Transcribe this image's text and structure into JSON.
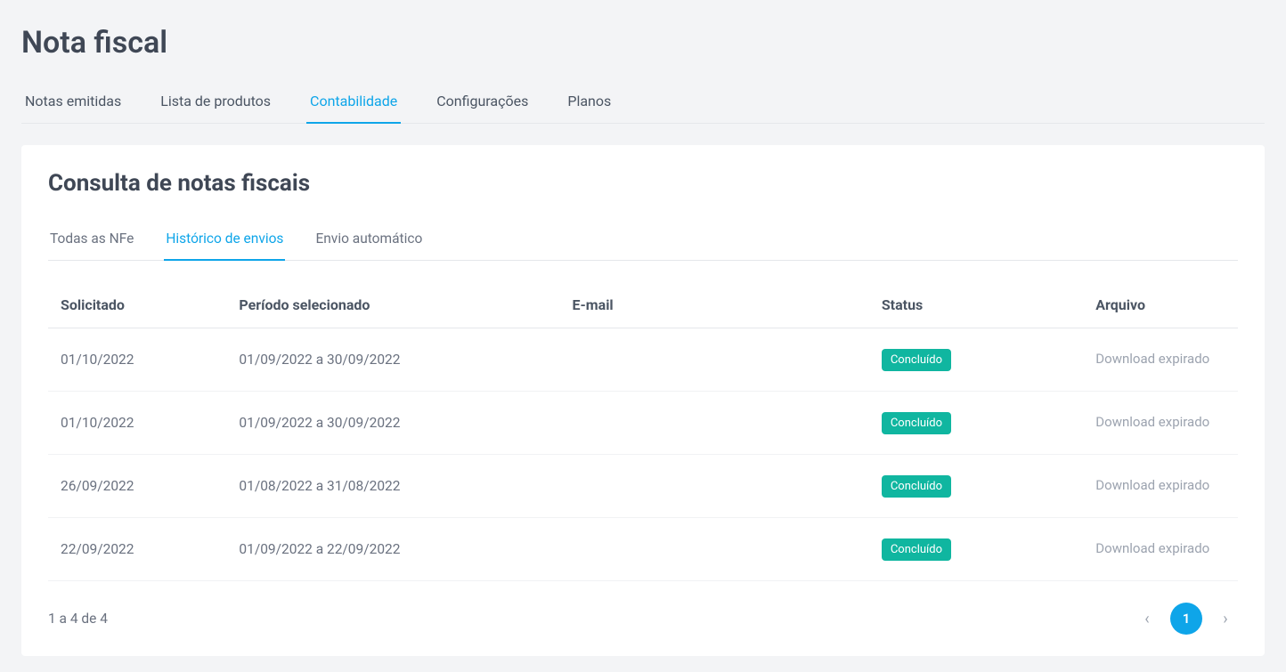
{
  "page": {
    "title": "Nota fiscal"
  },
  "mainTabs": [
    {
      "label": "Notas emitidas",
      "active": false
    },
    {
      "label": "Lista de produtos",
      "active": false
    },
    {
      "label": "Contabilidade",
      "active": true
    },
    {
      "label": "Configurações",
      "active": false
    },
    {
      "label": "Planos",
      "active": false
    }
  ],
  "card": {
    "title": "Consulta de notas fiscais"
  },
  "subTabs": [
    {
      "label": "Todas as NFe",
      "active": false
    },
    {
      "label": "Histórico de envios",
      "active": true
    },
    {
      "label": "Envio automático",
      "active": false
    }
  ],
  "table": {
    "headers": {
      "solicitado": "Solicitado",
      "periodo": "Período selecionado",
      "email": "E-mail",
      "status": "Status",
      "arquivo": "Arquivo"
    },
    "rows": [
      {
        "solicitado": "01/10/2022",
        "periodo": "01/09/2022 a 30/09/2022",
        "email": "",
        "status": "Concluído",
        "arquivo": "Download expirado"
      },
      {
        "solicitado": "01/10/2022",
        "periodo": "01/09/2022 a 30/09/2022",
        "email": "",
        "status": "Concluído",
        "arquivo": "Download expirado"
      },
      {
        "solicitado": "26/09/2022",
        "periodo": "01/08/2022 a 31/08/2022",
        "email": "",
        "status": "Concluído",
        "arquivo": "Download expirado"
      },
      {
        "solicitado": "22/09/2022",
        "periodo": "01/09/2022 a 22/09/2022",
        "email": "",
        "status": "Concluído",
        "arquivo": "Download expirado"
      }
    ]
  },
  "footer": {
    "count": "1 a 4 de 4",
    "pages": [
      "1"
    ]
  }
}
